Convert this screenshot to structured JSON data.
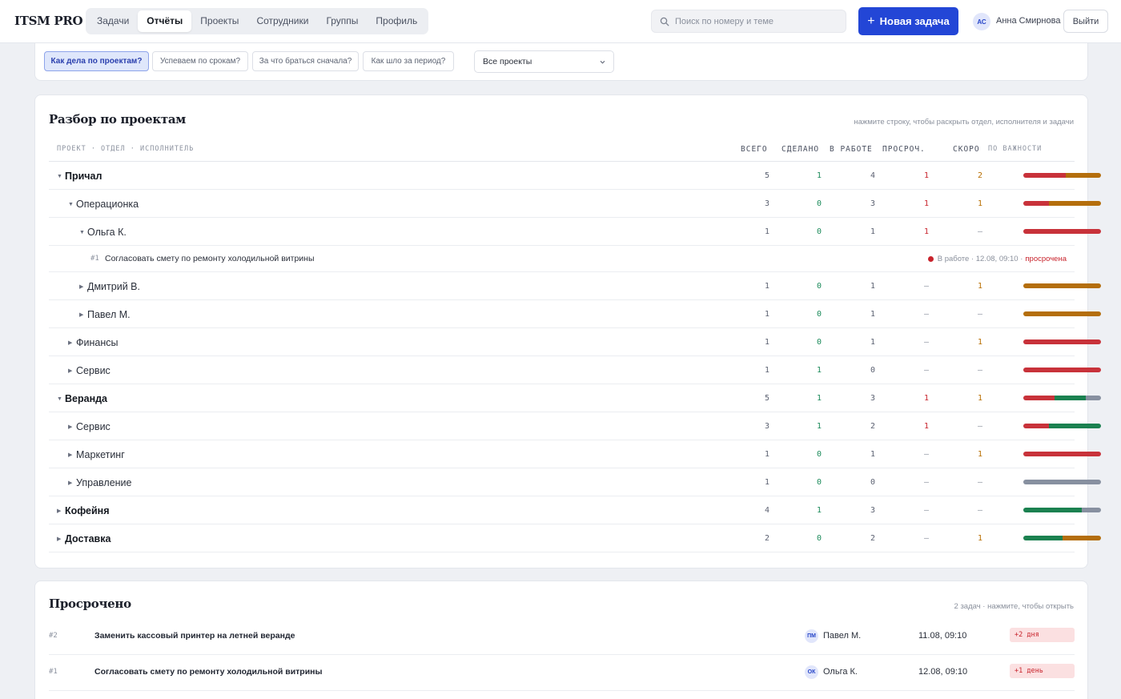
{
  "app": {
    "brand": "ITSM PRO"
  },
  "nav": {
    "tabs": [
      "Задачи",
      "Отчёты",
      "Проекты",
      "Сотрудники",
      "Группы",
      "Профиль"
    ],
    "active": "Отчёты"
  },
  "search": {
    "placeholder": "Поиск по номеру и теме"
  },
  "new_task": {
    "label": "Новая задача"
  },
  "user": {
    "initials": "АС",
    "name": "Анна Смирнова",
    "logout": "Выйти"
  },
  "filters": {
    "pills": [
      "Как дела по проектам?",
      "Успеваем по срокам?",
      "За что браться сначала?",
      "Как шло за период?"
    ],
    "active": "Как дела по проектам?",
    "project_select": "Все проекты"
  },
  "breakdown": {
    "title": "Разбор по проектам",
    "hint": "нажмите строку, чтобы раскрыть отдел, исполнителя и задачи",
    "headers": {
      "path": "ПРОЕКТ · ОТДЕЛ · ИСПОЛНИТЕЛЬ",
      "total": "ВСЕГО",
      "done": "СДЕЛАНО",
      "work": "В РАБОТЕ",
      "overdue": "ПРОСРОЧ.",
      "soon": "СКОРО",
      "priority": "ПО ВАЖНОСТИ"
    },
    "colors": {
      "red": "#c8323a",
      "orange": "#b46e0c",
      "green": "#1b8150",
      "gray": "#8790a0"
    },
    "rows": [
      {
        "level": 0,
        "expanded": true,
        "name": "Причал",
        "total": "5",
        "done": "1",
        "work": "4",
        "overdue": "1",
        "soon": "2",
        "priority": [
          {
            "c": "red",
            "v": 0.55
          },
          {
            "c": "orange",
            "v": 0.45
          }
        ]
      },
      {
        "level": 1,
        "expanded": true,
        "name": "Операционка",
        "total": "3",
        "done": "0",
        "work": "3",
        "overdue": "1",
        "soon": "1",
        "priority": [
          {
            "c": "red",
            "v": 0.33
          },
          {
            "c": "orange",
            "v": 0.67
          }
        ]
      },
      {
        "level": 2,
        "expanded": true,
        "name": "Ольга К.",
        "total": "1",
        "done": "0",
        "work": "1",
        "overdue": "1",
        "soon": "–",
        "priority": [
          {
            "c": "red",
            "v": 1
          }
        ]
      },
      {
        "task": true,
        "id": "#1",
        "title": "Согласовать смету по ремонту холодильной витрины",
        "status": "В работе · 12.08, 09:10 ·",
        "overdue_label": "просрочена"
      },
      {
        "level": 2,
        "expanded": false,
        "name": "Дмитрий В.",
        "total": "1",
        "done": "0",
        "work": "1",
        "overdue": "–",
        "soon": "1",
        "priority": [
          {
            "c": "orange",
            "v": 1
          }
        ]
      },
      {
        "level": 2,
        "expanded": false,
        "name": "Павел М.",
        "total": "1",
        "done": "0",
        "work": "1",
        "overdue": "–",
        "soon": "–",
        "priority": [
          {
            "c": "orange",
            "v": 1
          }
        ]
      },
      {
        "level": 1,
        "expanded": false,
        "name": "Финансы",
        "total": "1",
        "done": "0",
        "work": "1",
        "overdue": "–",
        "soon": "1",
        "priority": [
          {
            "c": "red",
            "v": 1
          }
        ]
      },
      {
        "level": 1,
        "expanded": false,
        "name": "Сервис",
        "total": "1",
        "done": "1",
        "work": "0",
        "overdue": "–",
        "soon": "–",
        "priority": [
          {
            "c": "red",
            "v": 1
          }
        ]
      },
      {
        "level": 0,
        "expanded": true,
        "name": "Веранда",
        "total": "5",
        "done": "1",
        "work": "3",
        "overdue": "1",
        "soon": "1",
        "priority": [
          {
            "c": "red",
            "v": 0.4
          },
          {
            "c": "green",
            "v": 0.4
          },
          {
            "c": "gray",
            "v": 0.2
          }
        ]
      },
      {
        "level": 1,
        "expanded": false,
        "name": "Сервис",
        "total": "3",
        "done": "1",
        "work": "2",
        "overdue": "1",
        "soon": "–",
        "priority": [
          {
            "c": "red",
            "v": 0.33
          },
          {
            "c": "green",
            "v": 0.67
          }
        ]
      },
      {
        "level": 1,
        "expanded": false,
        "name": "Маркетинг",
        "total": "1",
        "done": "0",
        "work": "1",
        "overdue": "–",
        "soon": "1",
        "priority": [
          {
            "c": "red",
            "v": 1
          }
        ]
      },
      {
        "level": 1,
        "expanded": false,
        "name": "Управление",
        "total": "1",
        "done": "0",
        "work": "0",
        "overdue": "–",
        "soon": "–",
        "priority": [
          {
            "c": "gray",
            "v": 1
          }
        ]
      },
      {
        "level": 0,
        "expanded": false,
        "name": "Кофейня",
        "total": "4",
        "done": "1",
        "work": "3",
        "overdue": "–",
        "soon": "–",
        "priority": [
          {
            "c": "green",
            "v": 0.75
          },
          {
            "c": "gray",
            "v": 0.25
          }
        ]
      },
      {
        "level": 0,
        "expanded": false,
        "name": "Доставка",
        "total": "2",
        "done": "0",
        "work": "2",
        "overdue": "–",
        "soon": "1",
        "priority": [
          {
            "c": "green",
            "v": 0.5
          },
          {
            "c": "orange",
            "v": 0.5
          }
        ]
      }
    ]
  },
  "overdue": {
    "title": "Просрочено",
    "hint": "2 задач · нажмите, чтобы открыть",
    "rows": [
      {
        "id": "#2",
        "title": "Заменить кассовый принтер на летней веранде",
        "initials": "ПМ",
        "person": "Павел М.",
        "date": "11.08, 09:10",
        "badge": "+2 дня"
      },
      {
        "id": "#1",
        "title": "Согласовать смету по ремонту холодильной витрины",
        "initials": "ОК",
        "person": "Ольга К.",
        "date": "12.08, 09:10",
        "badge": "+1 день"
      }
    ]
  }
}
